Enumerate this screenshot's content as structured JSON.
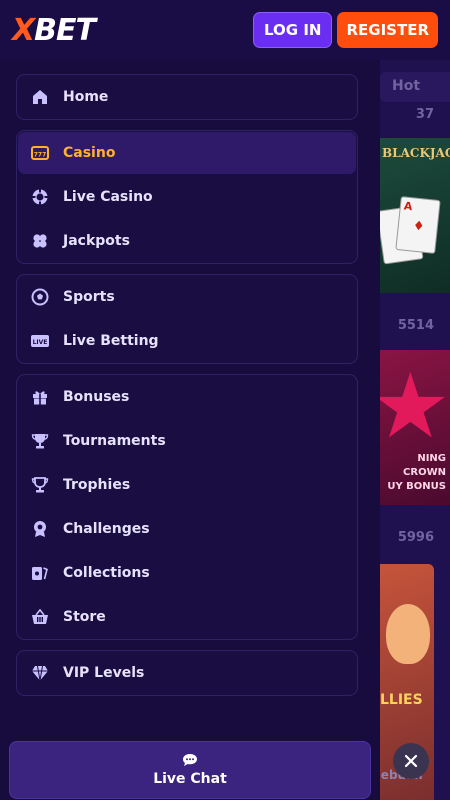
{
  "header": {
    "logo_x": "X",
    "logo_rest": "BET",
    "login_label": "LOG IN",
    "register_label": "REGISTER"
  },
  "background": {
    "tab_label": "Hot",
    "counts": [
      "37",
      "5514",
      "5996"
    ],
    "card1_title": "BLACKJACK",
    "card2_text": [
      "NING CROWN",
      "UY BONUS"
    ],
    "card3_text": "LLIES",
    "bottom_text": "Cebuan"
  },
  "menu": {
    "group1": [
      {
        "label": "Home",
        "icon": "home-icon"
      }
    ],
    "group2": [
      {
        "label": "Casino",
        "icon": "slot-machine-icon",
        "active": true
      },
      {
        "label": "Live Casino",
        "icon": "poker-chip-icon"
      },
      {
        "label": "Jackpots",
        "icon": "clover-icon"
      }
    ],
    "group3": [
      {
        "label": "Sports",
        "icon": "soccer-ball-icon"
      },
      {
        "label": "Live Betting",
        "icon": "live-badge-icon",
        "badge": "LIVE"
      }
    ],
    "group4": [
      {
        "label": "Bonuses",
        "icon": "gift-icon"
      },
      {
        "label": "Tournaments",
        "icon": "trophy-icon"
      },
      {
        "label": "Trophies",
        "icon": "trophy-cup-icon"
      },
      {
        "label": "Challenges",
        "icon": "medal-icon"
      },
      {
        "label": "Collections",
        "icon": "cards-icon"
      },
      {
        "label": "Store",
        "icon": "basket-icon"
      }
    ],
    "group5": [
      {
        "label": "VIP Levels",
        "icon": "diamond-icon"
      }
    ]
  },
  "footer": {
    "live_chat_label": "Live Chat"
  },
  "colors": {
    "brand_orange": "#ff4d0d",
    "brand_purple": "#6a2ef2",
    "active_text": "#ffb02e",
    "background": "#160b3a"
  }
}
